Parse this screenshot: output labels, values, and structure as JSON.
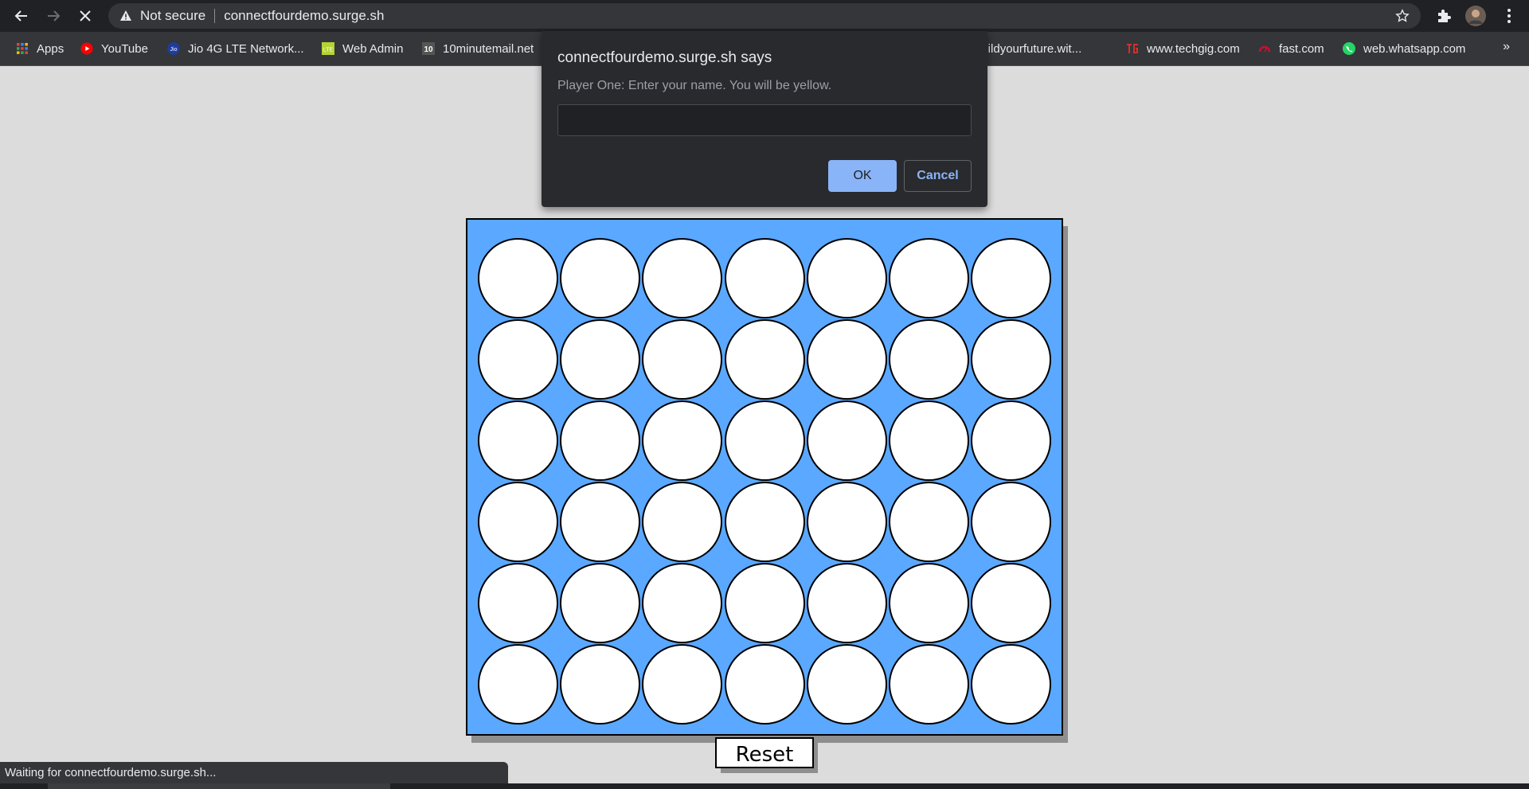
{
  "browser": {
    "security_label": "Not secure",
    "url": "connectfourdemo.surge.sh"
  },
  "bookmarks": [
    {
      "label": "Apps",
      "icon": "apps-grid-icon"
    },
    {
      "label": "YouTube",
      "icon": "youtube-icon"
    },
    {
      "label": "Jio 4G LTE Network...",
      "icon": "jio-icon"
    },
    {
      "label": "Web Admin",
      "icon": "lte-icon"
    },
    {
      "label": "10minutemail.net",
      "icon": "tenminutemail-icon"
    },
    {
      "label": "buildyourfuture.wit...",
      "icon": "globe-icon"
    },
    {
      "label": "www.techgig.com",
      "icon": "techgig-icon"
    },
    {
      "label": "fast.com",
      "icon": "fast-icon"
    },
    {
      "label": "web.whatsapp.com",
      "icon": "whatsapp-icon"
    }
  ],
  "bookmarks_more": "»",
  "dialog": {
    "title": "connectfourdemo.surge.sh says",
    "message": "Player One: Enter your name. You will be yellow.",
    "input_value": "",
    "ok_label": "OK",
    "cancel_label": "Cancel"
  },
  "game": {
    "rows": 6,
    "columns": 7,
    "reset_label": "Reset",
    "colors": {
      "board": "#5aa8ff",
      "empty_cell": "#ffffff"
    }
  },
  "status_text": "Waiting for connectfourdemo.surge.sh..."
}
